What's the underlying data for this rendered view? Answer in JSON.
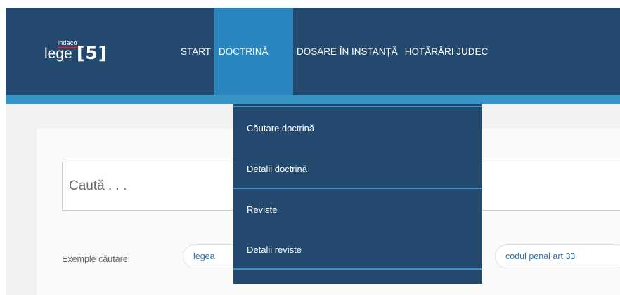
{
  "logo": {
    "small": "indaco",
    "word": "lege",
    "number": "[5]"
  },
  "nav": {
    "items": [
      {
        "label": "START",
        "active": false
      },
      {
        "label": "DOCTRINĂ",
        "active": true
      },
      {
        "label": "DOSARE ÎN INSTANȚĂ",
        "active": false
      },
      {
        "label": "HOTĂRÂRI JUDEC",
        "active": false
      }
    ]
  },
  "dropdown": {
    "items": [
      {
        "label": "Căutare doctrină"
      },
      {
        "label": "Detalii doctrină"
      },
      {
        "label": "Reviste"
      },
      {
        "label": "Detalii reviste"
      }
    ]
  },
  "search": {
    "placeholder": "Caută . . .",
    "value": ""
  },
  "examples": {
    "label": "Exemple căutare:",
    "chips": [
      "legea",
      "codul penal art 33"
    ]
  },
  "colors": {
    "header": "#234a6e",
    "accent": "#3a95c6",
    "active_tab": "#2a86bf",
    "link": "#2a6fa8"
  }
}
